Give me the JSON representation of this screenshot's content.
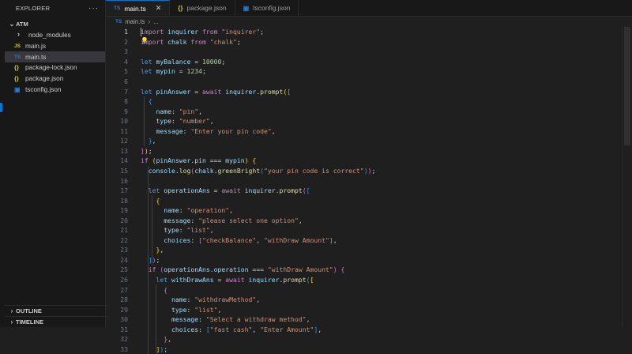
{
  "explorer": {
    "title": "EXPLORER",
    "more": "···",
    "folder": "ATM",
    "items": [
      {
        "icon": "›",
        "label": "node_modules",
        "type": "folder"
      },
      {
        "icon": "JS",
        "label": "main.js",
        "type": "js"
      },
      {
        "icon": "TS",
        "label": "main.ts",
        "type": "ts"
      },
      {
        "icon": "{}",
        "label": "package-lock.json",
        "type": "json"
      },
      {
        "icon": "{}",
        "label": "package.json",
        "type": "json"
      },
      {
        "icon": "▣",
        "label": "tsconfig.json",
        "type": "tsc"
      }
    ],
    "outline": "OUTLINE",
    "timeline": "TIMELINE"
  },
  "tabs": [
    {
      "icon": "TS",
      "label": "main.ts",
      "close": "✕"
    },
    {
      "icon": "{}",
      "label": "package.json"
    },
    {
      "icon": "▣",
      "label": "tsconfig.json"
    }
  ],
  "breadcrumb": {
    "icon": "TS",
    "file": "main.ts",
    "sep": "›",
    "rest": "..."
  },
  "code_lines": [
    {
      "n": "1",
      "t": [
        [
          "kw",
          "import"
        ],
        [
          "pu",
          " "
        ],
        [
          "var",
          "inquirer"
        ],
        [
          "pu",
          " "
        ],
        [
          "kw",
          "from"
        ],
        [
          "pu",
          " "
        ],
        [
          "str",
          "\"inquirer\""
        ],
        [
          "pu",
          ";"
        ]
      ]
    },
    {
      "n": "2",
      "t": [
        [
          "kw",
          "import"
        ],
        [
          "pu",
          " "
        ],
        [
          "var",
          "chalk"
        ],
        [
          "pu",
          " "
        ],
        [
          "kw",
          "from"
        ],
        [
          "pu",
          " "
        ],
        [
          "str",
          "\"chalk\""
        ],
        [
          "pu",
          ";"
        ]
      ]
    },
    {
      "n": "3",
      "t": []
    },
    {
      "n": "4",
      "t": [
        [
          "kb",
          "let"
        ],
        [
          "pu",
          " "
        ],
        [
          "var",
          "myBalance"
        ],
        [
          "pu",
          " = "
        ],
        [
          "num",
          "10000"
        ],
        [
          "pu",
          ";"
        ]
      ]
    },
    {
      "n": "5",
      "t": [
        [
          "kb",
          "let"
        ],
        [
          "pu",
          " "
        ],
        [
          "var",
          "mypin"
        ],
        [
          "pu",
          " = "
        ],
        [
          "num",
          "1234"
        ],
        [
          "pu",
          ";"
        ]
      ]
    },
    {
      "n": "6",
      "t": []
    },
    {
      "n": "7",
      "t": [
        [
          "kb",
          "let"
        ],
        [
          "pu",
          " "
        ],
        [
          "var",
          "pinAnswer"
        ],
        [
          "pu",
          " = "
        ],
        [
          "kw",
          "await"
        ],
        [
          "pu",
          " "
        ],
        [
          "var",
          "inquirer"
        ],
        [
          "pu",
          "."
        ],
        [
          "fn",
          "prompt"
        ],
        [
          "b1",
          "("
        ],
        [
          "b2",
          "["
        ]
      ]
    },
    {
      "n": "8",
      "t": [
        [
          "pu",
          "  "
        ],
        [
          "b3",
          "{"
        ]
      ]
    },
    {
      "n": "9",
      "t": [
        [
          "pu",
          "    "
        ],
        [
          "var",
          "name"
        ],
        [
          "pu",
          ": "
        ],
        [
          "str",
          "\"pin\""
        ],
        [
          "pu",
          ","
        ]
      ]
    },
    {
      "n": "10",
      "t": [
        [
          "pu",
          "    "
        ],
        [
          "var",
          "type"
        ],
        [
          "pu",
          ": "
        ],
        [
          "str",
          "\"number\""
        ],
        [
          "pu",
          ","
        ]
      ]
    },
    {
      "n": "11",
      "t": [
        [
          "pu",
          "    "
        ],
        [
          "var",
          "message"
        ],
        [
          "pu",
          ": "
        ],
        [
          "str",
          "\"Enter your pin code\""
        ],
        [
          "pu",
          ","
        ]
      ]
    },
    {
      "n": "12",
      "t": [
        [
          "pu",
          "  "
        ],
        [
          "b3",
          "}"
        ],
        [
          "pu",
          ","
        ]
      ]
    },
    {
      "n": "13",
      "t": [
        [
          "b2",
          "]"
        ],
        [
          "b1",
          ")"
        ],
        [
          "pu",
          ";"
        ]
      ]
    },
    {
      "n": "14",
      "t": [
        [
          "kw",
          "if"
        ],
        [
          "pu",
          " "
        ],
        [
          "b1",
          "("
        ],
        [
          "var",
          "pinAnswer"
        ],
        [
          "pu",
          "."
        ],
        [
          "var",
          "pin"
        ],
        [
          "pu",
          " === "
        ],
        [
          "var",
          "mypin"
        ],
        [
          "b1",
          ")"
        ],
        [
          "pu",
          " "
        ],
        [
          "b1",
          "{"
        ]
      ]
    },
    {
      "n": "15",
      "t": [
        [
          "pu",
          "  "
        ],
        [
          "var",
          "console"
        ],
        [
          "pu",
          "."
        ],
        [
          "fn",
          "log"
        ],
        [
          "b2",
          "("
        ],
        [
          "var",
          "chalk"
        ],
        [
          "pu",
          "."
        ],
        [
          "fn",
          "greenBright"
        ],
        [
          "b3",
          "("
        ],
        [
          "str",
          "\"your pin code is correct\""
        ],
        [
          "b3",
          ")"
        ],
        [
          "b2",
          ")"
        ],
        [
          "pu",
          ";"
        ]
      ]
    },
    {
      "n": "16",
      "t": []
    },
    {
      "n": "17",
      "t": [
        [
          "pu",
          "  "
        ],
        [
          "kb",
          "let"
        ],
        [
          "pu",
          " "
        ],
        [
          "var",
          "operationAns"
        ],
        [
          "pu",
          " = "
        ],
        [
          "kw",
          "await"
        ],
        [
          "pu",
          " "
        ],
        [
          "var",
          "inquirer"
        ],
        [
          "pu",
          "."
        ],
        [
          "fn",
          "prompt"
        ],
        [
          "b2",
          "("
        ],
        [
          "b3",
          "["
        ]
      ]
    },
    {
      "n": "18",
      "t": [
        [
          "pu",
          "    "
        ],
        [
          "b1",
          "{"
        ]
      ]
    },
    {
      "n": "19",
      "t": [
        [
          "pu",
          "      "
        ],
        [
          "var",
          "name"
        ],
        [
          "pu",
          ": "
        ],
        [
          "str",
          "\"operation\""
        ],
        [
          "pu",
          ","
        ]
      ]
    },
    {
      "n": "20",
      "t": [
        [
          "pu",
          "      "
        ],
        [
          "var",
          "message"
        ],
        [
          "pu",
          ": "
        ],
        [
          "str",
          "\"please select one option\""
        ],
        [
          "pu",
          ","
        ]
      ]
    },
    {
      "n": "21",
      "t": [
        [
          "pu",
          "      "
        ],
        [
          "var",
          "type"
        ],
        [
          "pu",
          ": "
        ],
        [
          "str",
          "\"list\""
        ],
        [
          "pu",
          ","
        ]
      ]
    },
    {
      "n": "22",
      "t": [
        [
          "pu",
          "      "
        ],
        [
          "var",
          "choices"
        ],
        [
          "pu",
          ": "
        ],
        [
          "b2",
          "["
        ],
        [
          "str",
          "\"checkBalance\""
        ],
        [
          "pu",
          ", "
        ],
        [
          "str",
          "\"withDraw Amount\""
        ],
        [
          "b2",
          "]"
        ],
        [
          "pu",
          ","
        ]
      ]
    },
    {
      "n": "23",
      "t": [
        [
          "pu",
          "    "
        ],
        [
          "b1",
          "}"
        ],
        [
          "pu",
          ","
        ]
      ]
    },
    {
      "n": "24",
      "t": [
        [
          "pu",
          "  "
        ],
        [
          "b3",
          "]"
        ],
        [
          "b2",
          ")"
        ],
        [
          "pu",
          ";"
        ]
      ]
    },
    {
      "n": "25",
      "t": [
        [
          "pu",
          "  "
        ],
        [
          "kw",
          "if"
        ],
        [
          "pu",
          " "
        ],
        [
          "b2",
          "("
        ],
        [
          "var",
          "operationAns"
        ],
        [
          "pu",
          "."
        ],
        [
          "var",
          "operation"
        ],
        [
          "pu",
          " === "
        ],
        [
          "str",
          "\"withDraw Amount\""
        ],
        [
          "b2",
          ")"
        ],
        [
          "pu",
          " "
        ],
        [
          "b2",
          "{"
        ]
      ]
    },
    {
      "n": "26",
      "t": [
        [
          "pu",
          "    "
        ],
        [
          "kb",
          "let"
        ],
        [
          "pu",
          " "
        ],
        [
          "var",
          "withDrawAns"
        ],
        [
          "pu",
          " = "
        ],
        [
          "kw",
          "await"
        ],
        [
          "pu",
          " "
        ],
        [
          "var",
          "inquirer"
        ],
        [
          "pu",
          "."
        ],
        [
          "fn",
          "prompt"
        ],
        [
          "b3",
          "("
        ],
        [
          "b1",
          "["
        ]
      ]
    },
    {
      "n": "27",
      "t": [
        [
          "pu",
          "      "
        ],
        [
          "b2",
          "{"
        ]
      ]
    },
    {
      "n": "28",
      "t": [
        [
          "pu",
          "        "
        ],
        [
          "var",
          "name"
        ],
        [
          "pu",
          ": "
        ],
        [
          "str",
          "\"withdrawMethod\""
        ],
        [
          "pu",
          ","
        ]
      ]
    },
    {
      "n": "29",
      "t": [
        [
          "pu",
          "        "
        ],
        [
          "var",
          "type"
        ],
        [
          "pu",
          ": "
        ],
        [
          "str",
          "\"list\""
        ],
        [
          "pu",
          ","
        ]
      ]
    },
    {
      "n": "30",
      "t": [
        [
          "pu",
          "        "
        ],
        [
          "var",
          "message"
        ],
        [
          "pu",
          ": "
        ],
        [
          "str",
          "\"Select a withdraw method\""
        ],
        [
          "pu",
          ","
        ]
      ]
    },
    {
      "n": "31",
      "t": [
        [
          "pu",
          "        "
        ],
        [
          "var",
          "choices"
        ],
        [
          "pu",
          ": "
        ],
        [
          "b3",
          "["
        ],
        [
          "str",
          "\"fast cash\""
        ],
        [
          "pu",
          ", "
        ],
        [
          "str",
          "\"Enter Amount\""
        ],
        [
          "b3",
          "]"
        ],
        [
          "pu",
          ","
        ]
      ]
    },
    {
      "n": "32",
      "t": [
        [
          "pu",
          "      "
        ],
        [
          "b2",
          "}"
        ],
        [
          "pu",
          ","
        ]
      ]
    },
    {
      "n": "33",
      "t": [
        [
          "pu",
          "    "
        ],
        [
          "b1",
          "]"
        ],
        [
          "b3",
          ")"
        ],
        [
          "pu",
          ";"
        ]
      ]
    }
  ]
}
